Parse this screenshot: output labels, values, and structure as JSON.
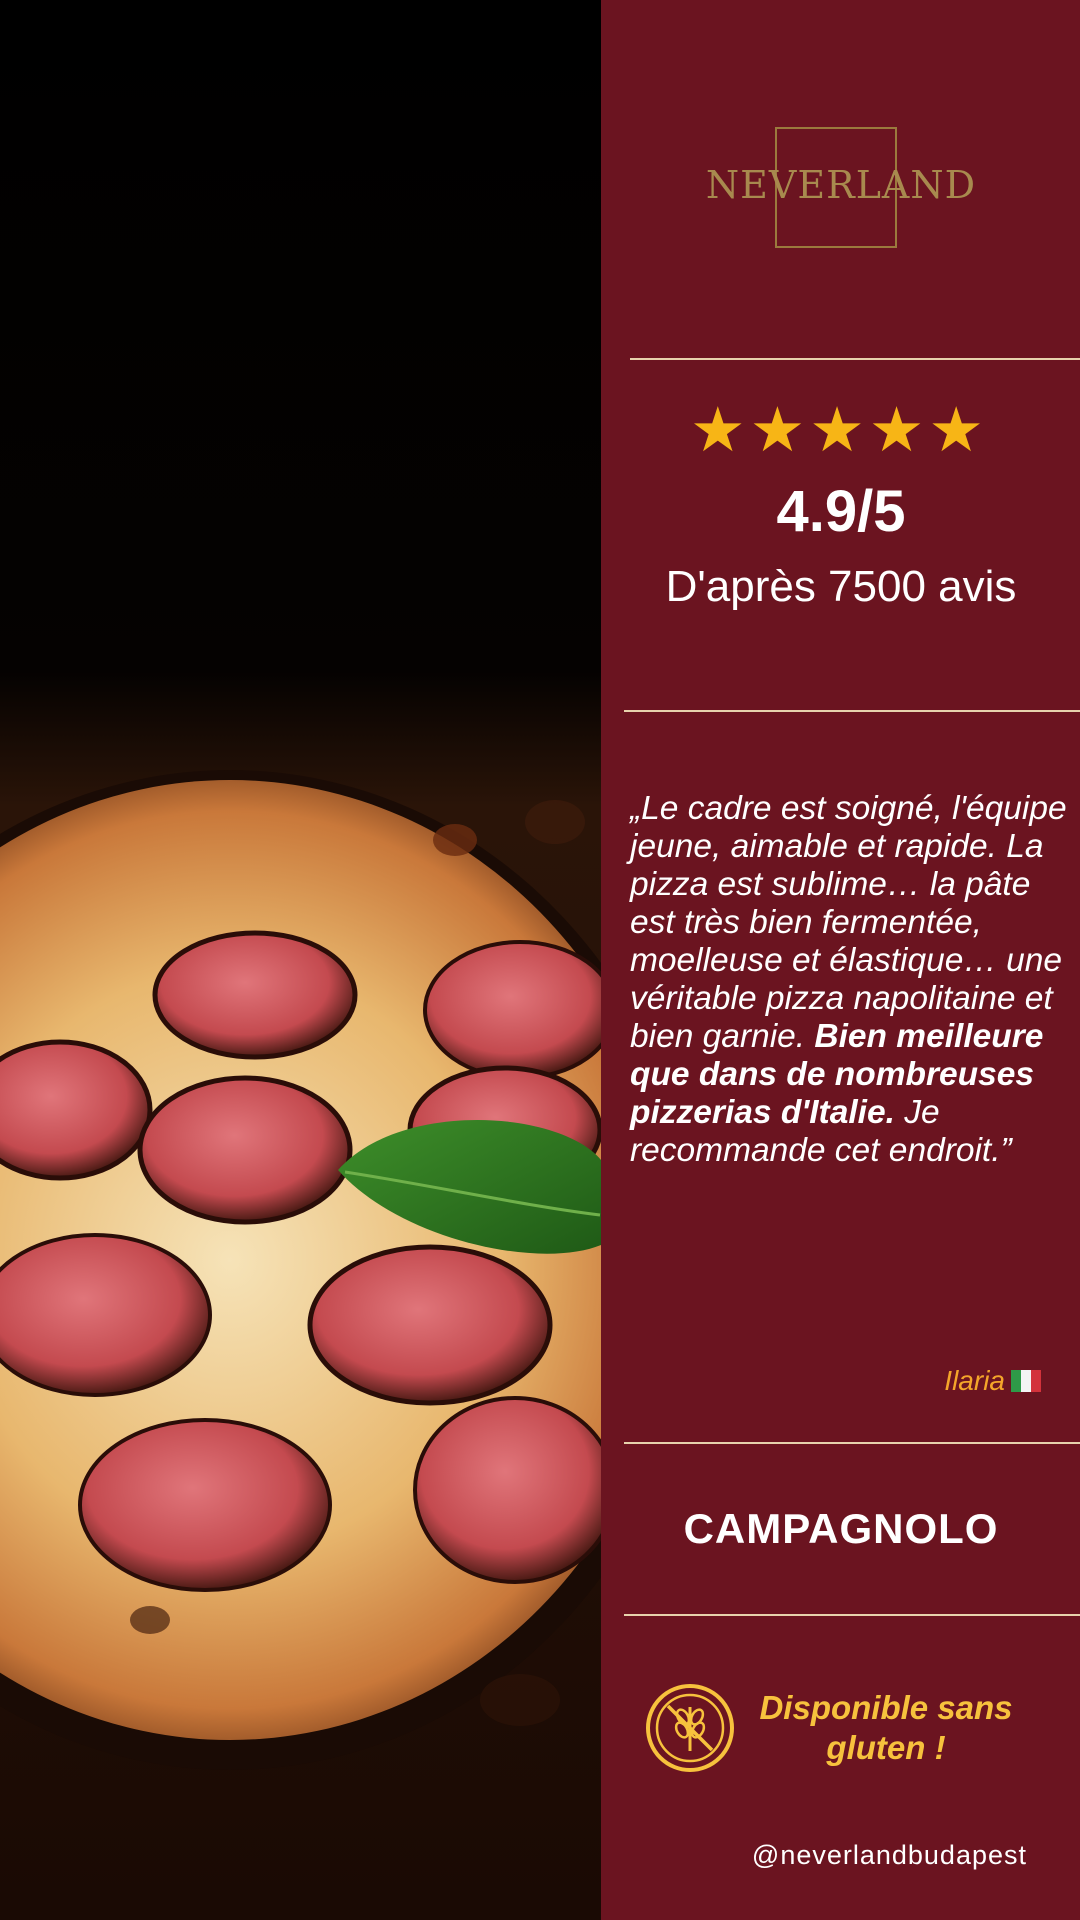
{
  "brand": {
    "logo_text": "NEVERLAND"
  },
  "rating": {
    "stars": "★★★★★",
    "score": "4.9/5",
    "based_on": "D'après 7500 avis",
    "stars_value": 5
  },
  "review": {
    "text_before": "„Le cadre est soigné, l'équipe jeune, aimable et rapide. La pizza est sublime… la pâte est très bien fermentée, moelleuse et élastique… une véritable pizza napolitaine et bien garnie. ",
    "text_bold": "Bien meilleure que dans de nombreuses pizzerias d'Italie.",
    "text_after": " Je recommande cet endroit.”",
    "reviewer": "Ilaria",
    "reviewer_flag": "italy-flag-icon"
  },
  "product": {
    "name": "CAMPAGNOLO"
  },
  "gluten_free": {
    "text": "Disponible sans gluten !",
    "icon": "gluten-free-icon"
  },
  "social": {
    "handle": "@neverlandbudapest"
  },
  "colors": {
    "panel": "#6b1420",
    "rule": "#e8d3ad",
    "star": "#f7b516",
    "accent_text": "#f7c23d",
    "reviewer": "#f4a52a",
    "logo_gold": "#a88a4e"
  }
}
